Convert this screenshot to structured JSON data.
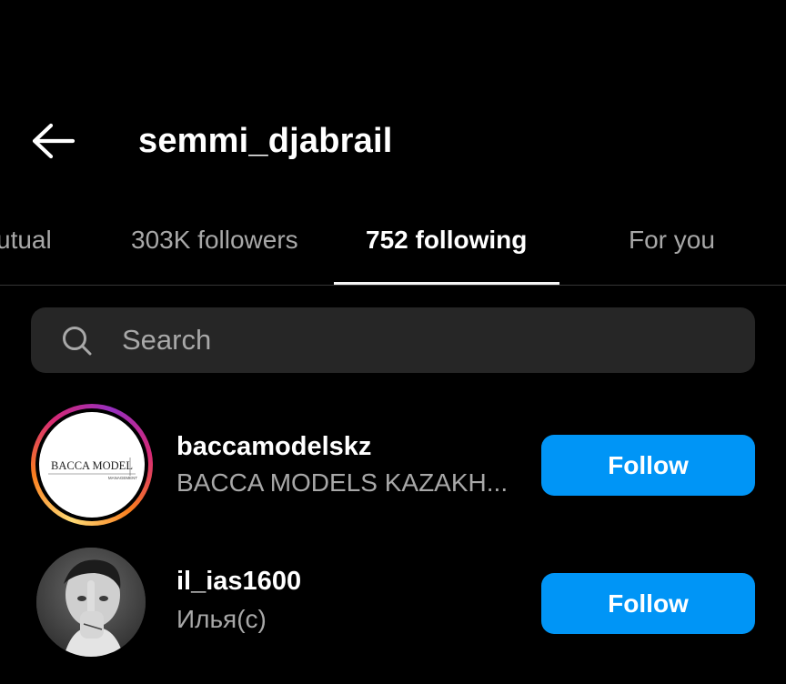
{
  "header": {
    "back_icon": "arrow-left-icon",
    "title": "semmi_djabrail"
  },
  "tabs": [
    {
      "label": "utual",
      "active": false
    },
    {
      "label": "303K followers",
      "active": false
    },
    {
      "label": "752 following",
      "active": true
    },
    {
      "label": "For you",
      "active": false
    }
  ],
  "search": {
    "icon": "search-icon",
    "placeholder": "Search",
    "value": ""
  },
  "accounts": [
    {
      "username": "baccamodelskz",
      "full_name": "BACCA MODELS KAZAKH...",
      "has_story_ring": true,
      "avatar_logo_text": "BACCA MODEL",
      "avatar_logo_subtext": "MANAGEMENT",
      "button_label": "Follow"
    },
    {
      "username": "il_ias1600",
      "full_name": "Илья(с)",
      "has_story_ring": false,
      "button_label": "Follow"
    }
  ],
  "colors": {
    "background": "#000000",
    "accent_button": "#0095f6",
    "secondary_text": "#a8a8a8",
    "search_background": "#262626"
  }
}
